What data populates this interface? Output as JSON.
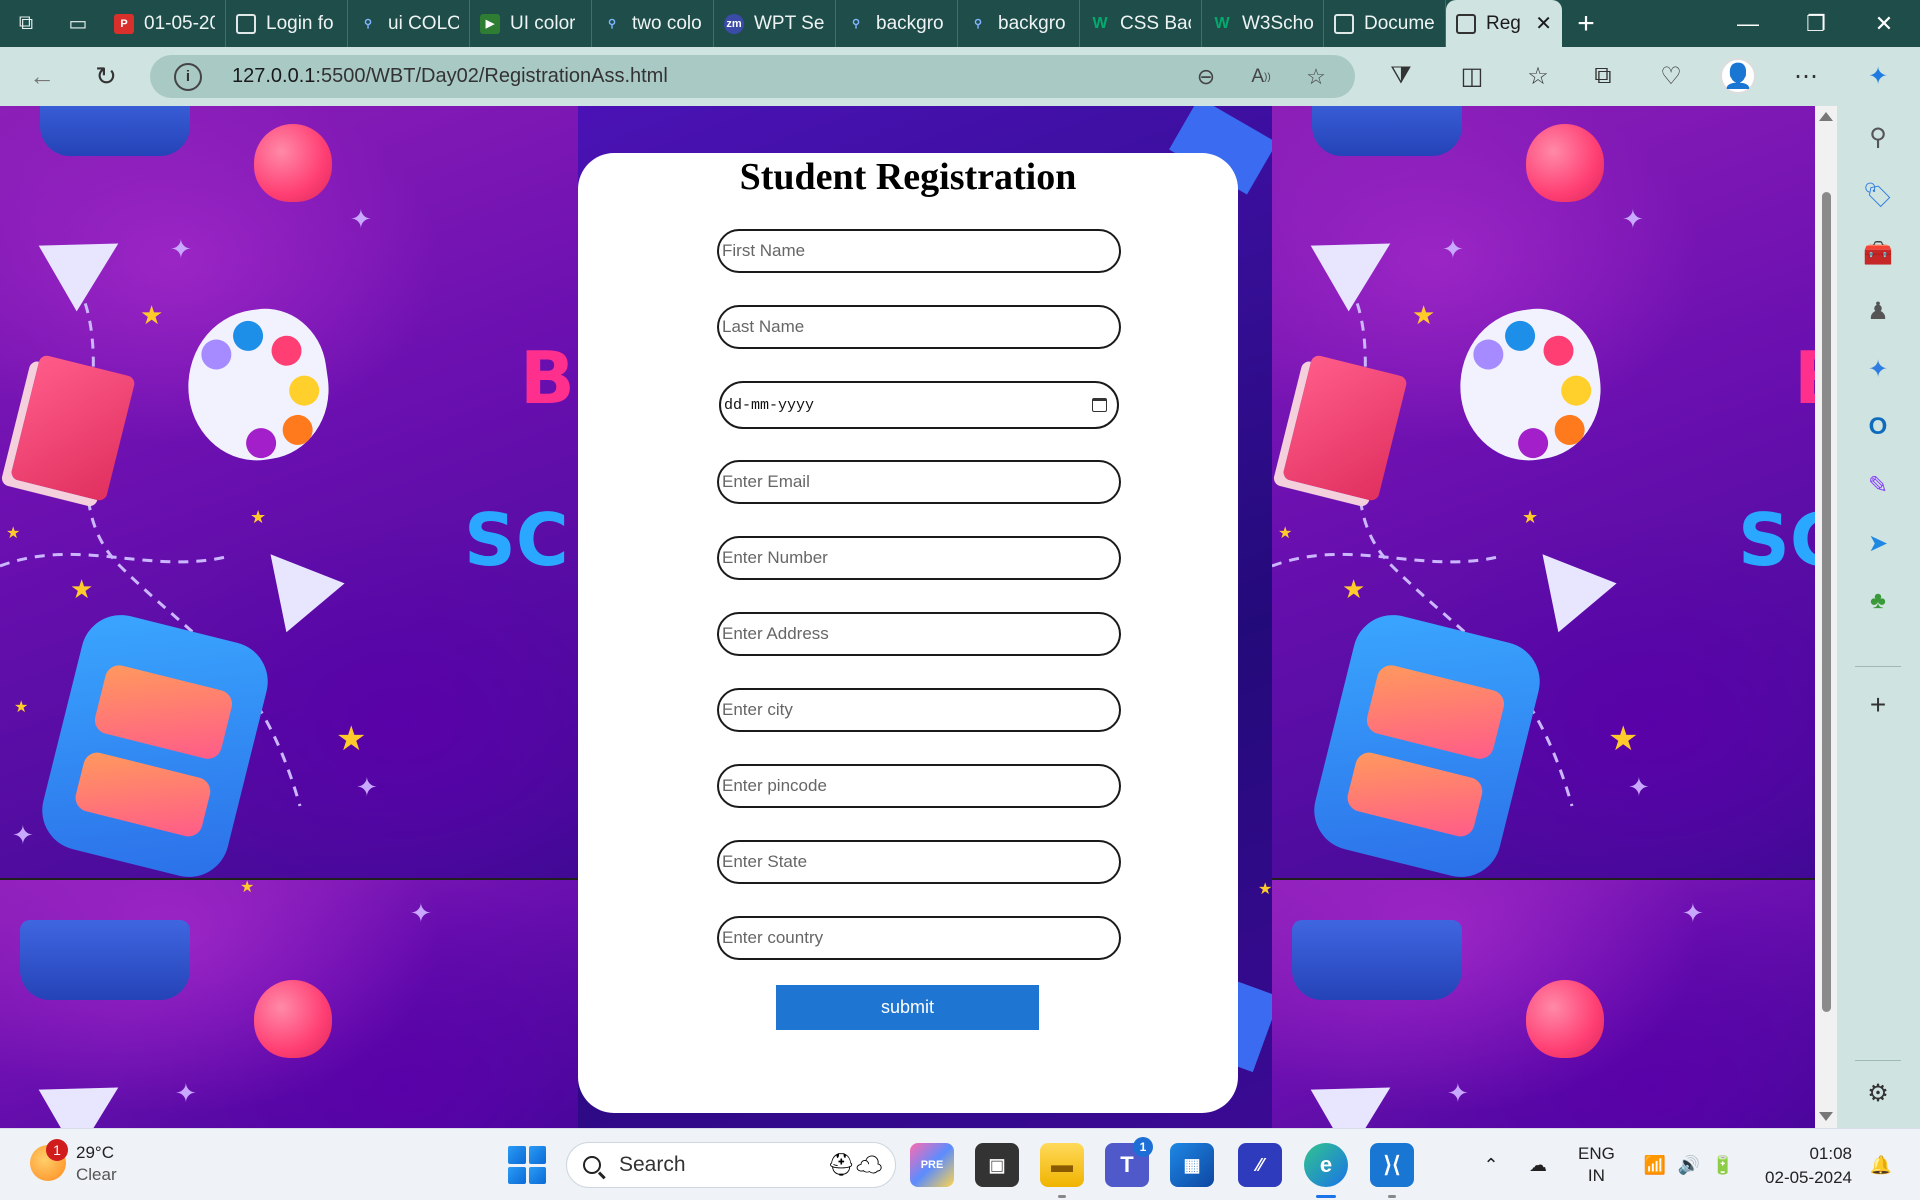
{
  "browser": {
    "tabs": [
      {
        "label": "01-05-20",
        "icon": "pdf-icon",
        "color": "#d9302c"
      },
      {
        "label": "Login fo",
        "icon": "page-icon",
        "color": "#6f7f7d"
      },
      {
        "label": "ui COLO",
        "icon": "search-icon",
        "color": "#2a66c9"
      },
      {
        "label": "UI color",
        "icon": "play-icon",
        "color": "#2e7d32"
      },
      {
        "label": "two colo",
        "icon": "search-icon",
        "color": "#2a66c9"
      },
      {
        "label": "WPT Ses",
        "icon": "zoom-icon",
        "color": "#3a4ba8"
      },
      {
        "label": "backgro",
        "icon": "search-icon",
        "color": "#2a66c9"
      },
      {
        "label": "backgro",
        "icon": "search-icon",
        "color": "#2a66c9"
      },
      {
        "label": "CSS Bac",
        "icon": "w3-icon",
        "color": "#04aa6d"
      },
      {
        "label": "W3Scho",
        "icon": "w3-icon",
        "color": "#04aa6d"
      },
      {
        "label": "Docume",
        "icon": "page-icon",
        "color": "#6f7f7d"
      }
    ],
    "active_tab": {
      "label": "Reg",
      "close": "✕"
    },
    "url_host": "127.0.0.1",
    "url_path": ":5500/WBT/Day02/RegistrationAss.html"
  },
  "page": {
    "bg_words": {
      "left_top": "B",
      "left_mid": "SC",
      "right_top": "B",
      "right_mid": "SC"
    },
    "form": {
      "title": "Student Registration",
      "first_name_placeholder": "First Name",
      "last_name_placeholder": "Last Name",
      "dob_value": "dd-mm-yyyy",
      "email_placeholder": "Enter Email",
      "number_placeholder": "Enter Number",
      "address_placeholder": "Enter Address",
      "city_placeholder": "Enter city",
      "pincode_placeholder": "Enter pincode",
      "state_placeholder": "Enter State",
      "country_placeholder": "Enter country",
      "submit_label": "submit"
    }
  },
  "taskbar": {
    "weather_temp": "29°C",
    "weather_desc": "Clear",
    "weather_badge": "1",
    "search_label": "Search",
    "teams_badge": "1",
    "lang_line1": "ENG",
    "lang_line2": "IN",
    "time": "01:08",
    "date": "02-05-2024"
  },
  "colors": {
    "tabstrip": "#1e4d4a",
    "toolbar": "#cfe3e1",
    "submit": "#1f75d2",
    "background_purple": "#6a0fb0"
  }
}
